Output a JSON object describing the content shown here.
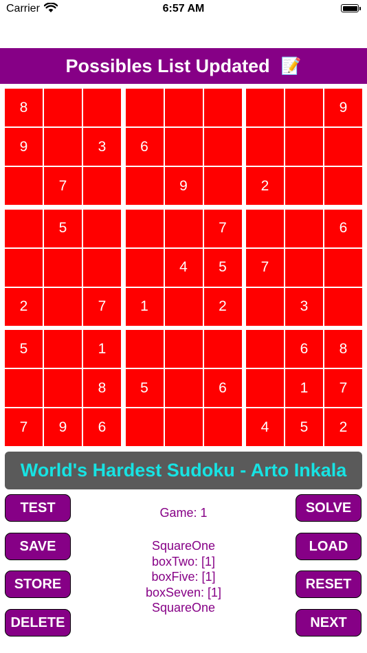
{
  "status_bar": {
    "carrier": "Carrier",
    "time": "6:57 AM"
  },
  "banner": {
    "text": "Possibles List Updated",
    "emoji": "📝"
  },
  "board": {
    "rows": [
      [
        "8",
        "",
        "",
        "",
        "",
        "",
        "",
        "",
        "9"
      ],
      [
        "9",
        "",
        "3",
        "6",
        "",
        "",
        "",
        "",
        ""
      ],
      [
        "",
        "7",
        "",
        "",
        "9",
        "",
        "2",
        "",
        ""
      ],
      [
        "",
        "5",
        "",
        "",
        "",
        "7",
        "",
        "",
        "6"
      ],
      [
        "",
        "",
        "",
        "",
        "4",
        "5",
        "7",
        "",
        ""
      ],
      [
        "2",
        "",
        "7",
        "1",
        "",
        "2",
        "",
        "3",
        ""
      ],
      [
        "5",
        "",
        "1",
        "",
        "",
        "",
        "",
        "6",
        "8"
      ],
      [
        "",
        "",
        "8",
        "5",
        "",
        "6",
        "",
        "1",
        "7"
      ],
      [
        "7",
        "9",
        "6",
        "",
        "",
        "",
        "4",
        "5",
        "2"
      ]
    ]
  },
  "puzzle_title": "World's Hardest Sudoku - Arto Inkala",
  "buttons": {
    "test": "TEST",
    "save": "SAVE",
    "store": "STORE",
    "delete": "DELETE",
    "solve": "SOLVE",
    "load": "LOAD",
    "reset": "RESET",
    "next": "NEXT"
  },
  "game_label": "Game:  1",
  "info_lines": [
    "SquareOne",
    "boxTwo: [1]",
    "boxFive: [1]",
    "boxSeven: [1]",
    "SquareOne"
  ],
  "colors": {
    "cell": "#ff0000",
    "banner": "#860086",
    "title_text": "#17e3e3",
    "title_bg": "#5a5a5a"
  }
}
